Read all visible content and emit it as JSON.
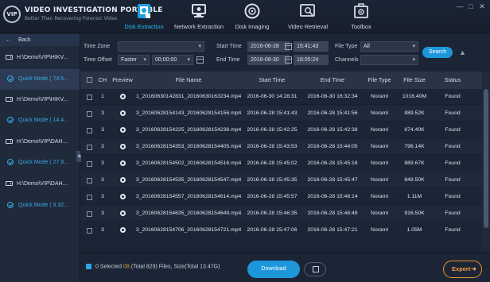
{
  "app": {
    "logo": "VIP",
    "title": "VIDEO INVESTIGATION PORTABLE",
    "subtitle": "Better Than Recovering Forensic Video"
  },
  "nav": {
    "tabs": [
      {
        "label": "Disk Extraction",
        "icon": "disk-extraction-icon",
        "active": true
      },
      {
        "label": "Network Extraction",
        "icon": "network-extraction-icon",
        "active": false
      },
      {
        "label": "Disk Imaging",
        "icon": "disk-imaging-icon",
        "active": false
      },
      {
        "label": "Video Retrieval",
        "icon": "video-retrieval-icon",
        "active": false
      },
      {
        "label": "Toolbox",
        "icon": "toolbox-icon",
        "active": false
      }
    ]
  },
  "sidebar": {
    "back_label": "Back",
    "sources": [
      {
        "path": "H:\\Demo\\VIP\\HIKV...",
        "mode": "Quick Mode ( 74.5...",
        "selected": true
      },
      {
        "path": "H:\\Demo\\VIP\\HIKV...",
        "mode": "Quick Mode ( 14.4...",
        "selected": false
      },
      {
        "path": "H:\\Demo\\VIP\\DAH...",
        "mode": "Quick Mode ( 27.9...",
        "selected": false
      },
      {
        "path": "H:\\Demo\\VIP\\DAH...",
        "mode": "Quick Mode ( 9.32...",
        "selected": false
      }
    ]
  },
  "filters": {
    "time_zone_label": "Time Zone",
    "time_zone_value": "",
    "time_offset_label": "Time Offset",
    "time_offset_mode": "Faster",
    "time_offset_value": "00:00:00",
    "start_time_label": "Start Time",
    "start_date": "2016-06-28",
    "start_time": "15:41:43",
    "end_time_label": "End Time",
    "end_date": "2016-06-30",
    "end_time": "18:05:24",
    "file_type_label": "File Type",
    "file_type_value": "All",
    "channels_label": "Channels",
    "channels_value": "",
    "search_label": "Search"
  },
  "table": {
    "columns": [
      "CH",
      "Preview",
      "File Name",
      "Start Time",
      "End Time",
      "File Type",
      "File Size",
      "Status"
    ],
    "rows": [
      {
        "ch": "1",
        "name": "1_20160630142831_20160630163234.mp4",
        "start": "2016-06-30 14:28:31",
        "end": "2016-06-30 16:32:34",
        "type": "Noraml",
        "size": "1016.40M",
        "status": "Found"
      },
      {
        "ch": "3",
        "name": "3_20160628154143_20160628154156.mp4",
        "start": "2016-06-28 15:41:43",
        "end": "2016-06-28 15:41:56",
        "type": "Noraml",
        "size": "889.52K",
        "status": "Found"
      },
      {
        "ch": "3",
        "name": "3_20160628154225_20160628154238.mp4",
        "start": "2016-06-28 15:42:25",
        "end": "2016-06-28 15:42:38",
        "type": "Noraml",
        "size": "874.40K",
        "status": "Found"
      },
      {
        "ch": "3",
        "name": "3_20160628154353_20160628154405.mp4",
        "start": "2016-06-28 15:43:53",
        "end": "2016-06-28 15:44:05",
        "type": "Noraml",
        "size": "796.14K",
        "status": "Found"
      },
      {
        "ch": "3",
        "name": "3_20160628154502_20160628154516.mp4",
        "start": "2016-06-28 15:45:02",
        "end": "2016-06-28 15:45:16",
        "type": "Noraml",
        "size": "889.67K",
        "status": "Found"
      },
      {
        "ch": "3",
        "name": "3_20160628154535_20160628154547.mp4",
        "start": "2016-06-28 15:45:35",
        "end": "2016-06-28 15:45:47",
        "type": "Noraml",
        "size": "848.50K",
        "status": "Found"
      },
      {
        "ch": "3",
        "name": "3_20160628154557_20160628154614.mp4",
        "start": "2016-06-28 15:45:57",
        "end": "2016-06-28 15:46:14",
        "type": "Noraml",
        "size": "1.11M",
        "status": "Found"
      },
      {
        "ch": "3",
        "name": "3_20160628154635_20160628154649.mp4",
        "start": "2016-06-28 15:46:35",
        "end": "2016-06-28 15:46:49",
        "type": "Noraml",
        "size": "916.50K",
        "status": "Found"
      },
      {
        "ch": "3",
        "name": "3_20160628154706_20160628154721.mp4",
        "start": "2016-06-28 15:47:06",
        "end": "2016-06-28 15:47:21",
        "type": "Noraml",
        "size": "1.05M",
        "status": "Found"
      }
    ]
  },
  "footer": {
    "selected_count": "0",
    "selected_label": "Selected",
    "file_count": "08",
    "total_text": "(Total 829) Files, Size(Total 13.47G)",
    "download_label": "Download",
    "expert_label": "Expert"
  },
  "colors": {
    "accent": "#1e97da",
    "active_tab": "#27b6f2",
    "expert": "#e8962d",
    "background": "#1c2535"
  }
}
